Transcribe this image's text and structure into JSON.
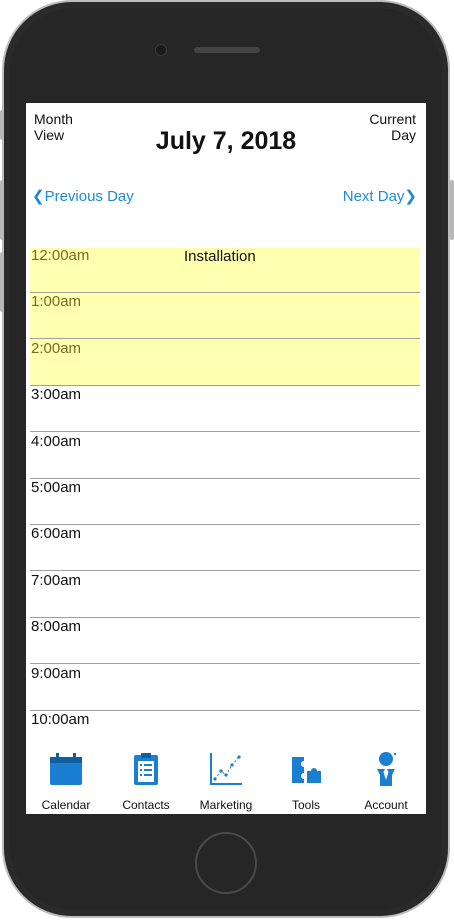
{
  "header": {
    "month_view": "Month View",
    "current_day": "Current Day",
    "date_title": "July 7, 2018"
  },
  "nav": {
    "previous": "❮Previous Day",
    "next": "Next Day❯"
  },
  "event": {
    "title": "Installation"
  },
  "times": [
    "12:00am",
    "1:00am",
    "2:00am",
    "3:00am",
    "4:00am",
    "5:00am",
    "6:00am",
    "7:00am",
    "8:00am",
    "9:00am",
    "10:00am"
  ],
  "tabs": [
    {
      "label": "Calendar",
      "icon": "calendar-icon"
    },
    {
      "label": "Contacts",
      "icon": "clipboard-icon"
    },
    {
      "label": "Marketing",
      "icon": "chart-icon"
    },
    {
      "label": "Tools",
      "icon": "puzzle-icon"
    },
    {
      "label": "Account",
      "icon": "person-icon"
    }
  ],
  "colors": {
    "accent": "#1e8ad6",
    "highlight": "#ffffb0",
    "icon_blue": "#1a7fd0"
  }
}
